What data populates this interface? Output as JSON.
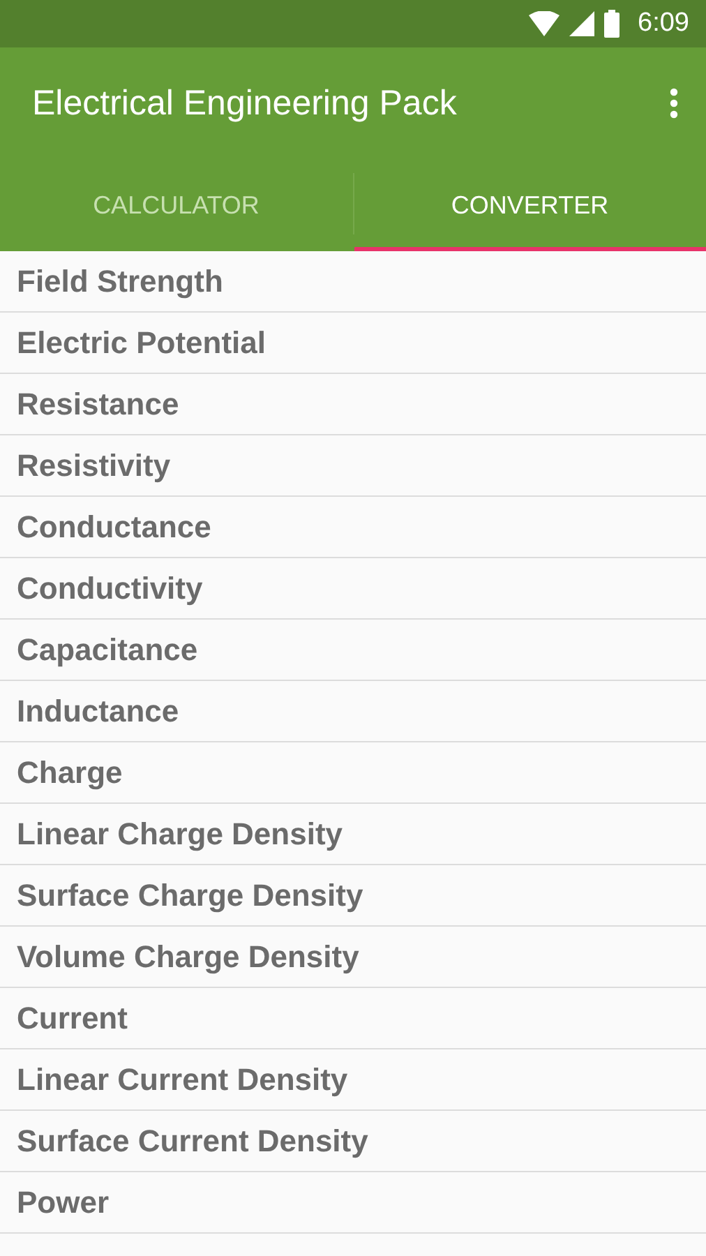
{
  "status_bar": {
    "time": "6:09"
  },
  "app_bar": {
    "title": "Electrical Engineering Pack"
  },
  "tabs": [
    {
      "label": "CALCULATOR",
      "selected": false
    },
    {
      "label": "CONVERTER",
      "selected": true
    }
  ],
  "list": {
    "items": [
      "Field Strength",
      "Electric Potential",
      "Resistance",
      "Resistivity",
      "Conductance",
      "Conductivity",
      "Capacitance",
      "Inductance",
      "Charge",
      "Linear Charge Density",
      "Surface Charge Density",
      "Volume Charge Density",
      "Current",
      "Linear Current Density",
      "Surface Current Density",
      "Power"
    ]
  }
}
